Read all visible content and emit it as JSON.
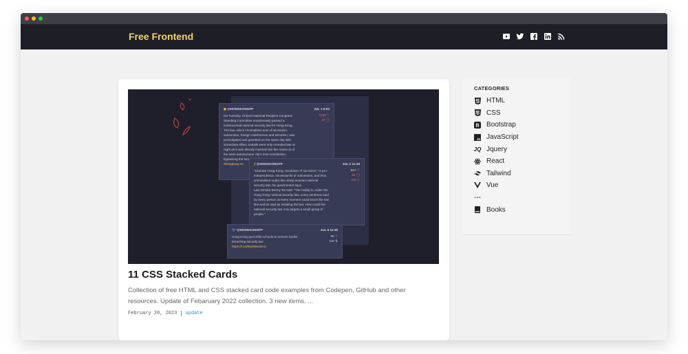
{
  "header": {
    "brand": "Free Frontend",
    "social_icons": [
      "youtube-icon",
      "twitter-icon",
      "facebook-icon",
      "linkedin-icon",
      "rss-icon"
    ]
  },
  "article": {
    "title": "11 CSS Stacked Cards",
    "description": "Collection of free HTML and CSS stacked card code examples from Codepen, GitHub and other resources. Update of Febaruary 2022 collection. 3 new items. ...",
    "date": "February 20, 2023",
    "tag": "update",
    "thumbnail": {
      "cards": [
        {
          "handle": "@HONGKONGFP",
          "date": "JUL 1 6:03",
          "stats": [
            "2155",
            "87"
          ],
          "text": [
            "On Tuesday, China's National People's Congress",
            "Standing Committee unanimously passed a",
            "controversial national security law for Hong Kong.",
            "The law, which criminalises acts of secession,",
            "subversion, foreign interference and terrorism, was",
            "promulgated and gazetted on the same day with",
            "immediate effect. Details were only revealed late at",
            "night as it was directly inserted into the Annex III of",
            "the semi-autonomous city's mini-constitution,",
            "bypassing the local legislature."
          ],
          "link": "#hongkong #c"
        },
        {
          "handle": "@HONGKONGFP",
          "date": "JUL 2 11:49",
          "stats": [
            "857",
            "54",
            "410"
          ],
          "text": [
            "\"Liberate Hong Kong; revolution of our times,\" is pro-",
            "independence, secessionist or subversive, and thus",
            "criminalised under the newly-enacted national",
            "security law, the government says.",
            "Law scholar Benny Tai said: \"The reality is, under the",
            "Hong Kong national security law, every sentence said",
            "by every person at every moment could touch the red",
            "line and be said as violating the law. How could the",
            "national security law only targets a small group of",
            "people.\""
          ]
        },
        {
          "handle": "@HONGKONGFP",
          "date": "JUL 6 11:36",
          "stats": [
            "96",
            "118"
          ],
          "text": [
            "Hong Kong gov't tells schools to remove books",
            "breaching security law"
          ],
          "link": "https://t.co/8vpMwxaxcU"
        }
      ]
    }
  },
  "sidebar": {
    "heading": "CATEGORIES",
    "items": [
      {
        "label": "HTML",
        "icon": "html5-icon"
      },
      {
        "label": "CSS",
        "icon": "css3-icon"
      },
      {
        "label": "Bootstrap",
        "icon": "bootstrap-icon"
      },
      {
        "label": "JavaScript",
        "icon": "javascript-icon"
      },
      {
        "label": "Jquery",
        "icon": "jquery-icon"
      },
      {
        "label": "React",
        "icon": "react-icon"
      },
      {
        "label": "Tailwind",
        "icon": "tailwind-icon"
      },
      {
        "label": "Vue",
        "icon": "vue-icon"
      }
    ],
    "separator": "---",
    "extra": {
      "label": "Books",
      "icon": "book-icon"
    }
  },
  "colors": {
    "header_bg": "#1e1f26",
    "brand": "#f5d06a",
    "tag_link": "#2a8ad6",
    "chrome_red": "#ff5f57",
    "chrome_yellow": "#febc2e",
    "chrome_green": "#28c840"
  }
}
